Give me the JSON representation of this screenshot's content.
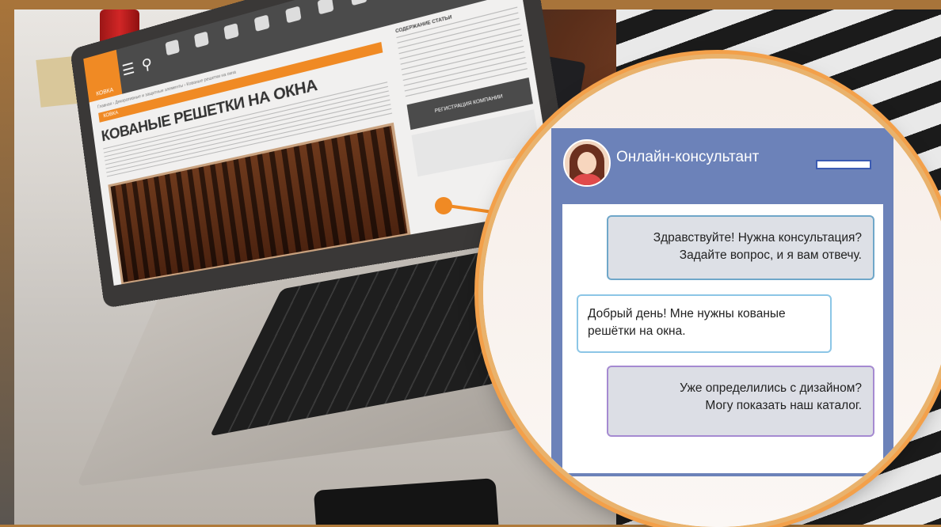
{
  "site": {
    "logo_text": "КОВКА",
    "nav_items": [
      "",
      "",
      "",
      "",
      "",
      "",
      "",
      "",
      ""
    ],
    "breadcrumbs": "Главная › Декоративные и защитные элементы › Кованые решетки на окна",
    "tag": "КОВКА",
    "article_title": "КОВАНЫЕ РЕШЕТКИ НА ОКНА",
    "sidebar_title": "СОДЕРЖАНИЕ СТАТЬИ",
    "register_label": "РЕГИСТРАЦИЯ КОМПАНИИ"
  },
  "chat": {
    "title": "Онлайн-консультант",
    "messages": {
      "operator_greeting_line1": "Здравствуйте! Нужна консультация?",
      "operator_greeting_line2": "Задайте вопрос, и я вам отвечу.",
      "user_line1": "Добрый день! Мне нужны кованые",
      "user_line2": "решётки на окна.",
      "operator_reply_line1": "Уже  определились с дизайном?",
      "operator_reply_line2": "Могу показать наш каталог."
    }
  },
  "colors": {
    "accent_orange": "#f08a24",
    "chat_frame": "#6c82b9",
    "operator_bubble": "#dde0e6",
    "user_bubble_border": "#8cc6e6"
  },
  "icons": {
    "hamburger": "menu-icon",
    "search": "search-icon",
    "avatar": "operator-avatar"
  }
}
